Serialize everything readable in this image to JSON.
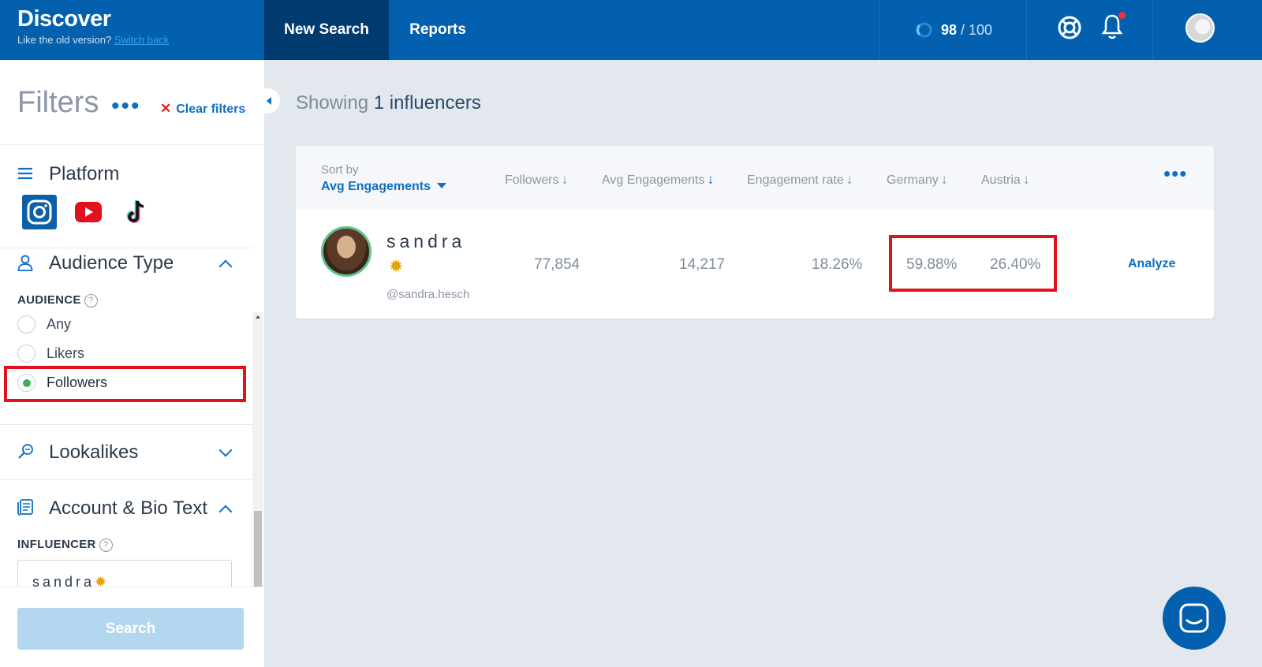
{
  "header": {
    "brand_title": "Discover",
    "brand_sub": "Like the old version?",
    "switch_back": "Switch back",
    "nav_new_search": "New Search",
    "nav_reports": "Reports",
    "credits_used": "98",
    "credits_total": "/ 100",
    "accent": "#0360ae"
  },
  "sidebar": {
    "filters_title": "Filters",
    "more_label": "•••",
    "clear_filters": "Clear filters",
    "platform": {
      "title": "Platform",
      "icons": [
        "instagram-icon",
        "youtube-icon",
        "tiktok-icon"
      ]
    },
    "audience_type": {
      "title": "Audience Type",
      "audience_label": "AUDIENCE",
      "options": [
        "Any",
        "Likers",
        "Followers"
      ],
      "selected": "Followers"
    },
    "lookalikes": {
      "title": "Lookalikes"
    },
    "account_bio": {
      "title": "Account & Bio Text",
      "influencer_label": "INFLUENCER",
      "influencer_value": "sandra"
    },
    "search_button": "Search"
  },
  "main": {
    "showing_prefix": "Showing",
    "showing_count": "1 influencers",
    "sort_by_label": "Sort by",
    "sort_by_value": "Avg Engagements",
    "columns": [
      "Followers",
      "Avg Engagements",
      "Engagement rate",
      "Germany",
      "Austria"
    ],
    "more_label": "•••",
    "rows": [
      {
        "name": "sandra",
        "handle": "@sandra.hesch",
        "followers": "77,854",
        "avg_engagements": "14,217",
        "engagement_rate": "18.26%",
        "germany": "59.88%",
        "austria": "26.40%",
        "action": "Analyze"
      }
    ]
  }
}
